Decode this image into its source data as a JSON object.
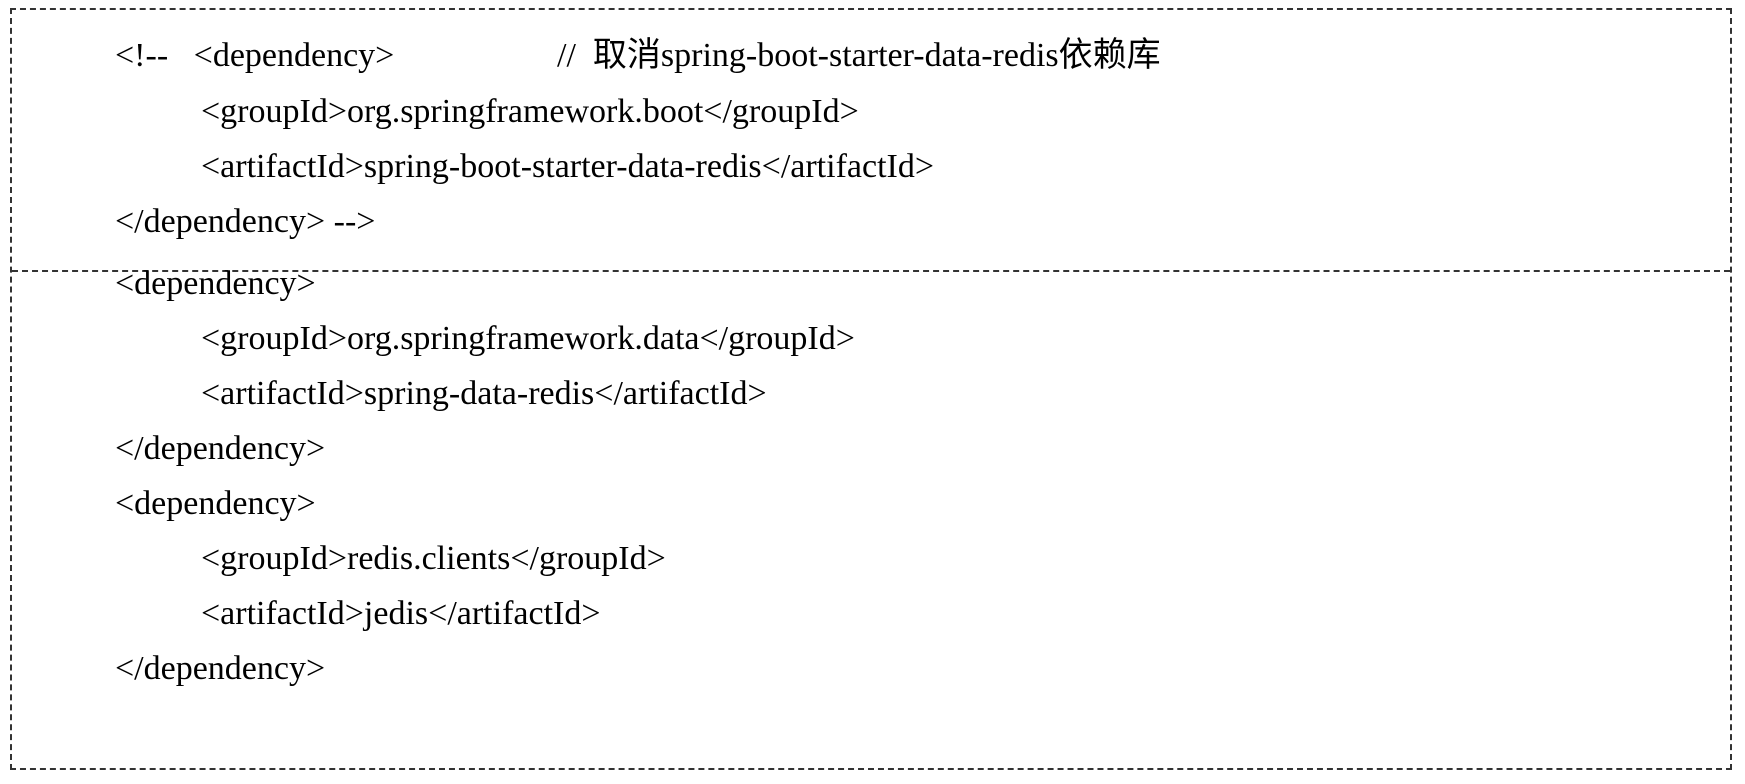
{
  "section_1": {
    "lines": [
      {
        "text": "<!--   <dependency>"
      },
      {
        "text": "<groupId>org.springframework.boot</groupId>"
      },
      {
        "text": "<artifactId>spring-boot-starter-data-redis</artifactId>"
      },
      {
        "text": "</dependency> -->"
      }
    ],
    "comment": "//  取消spring-boot-starter-data-redis依赖库"
  },
  "section_2": {
    "lines": [
      {
        "text": "<dependency>"
      },
      {
        "text": "<groupId>org.springframework.data</groupId>"
      },
      {
        "text": "<artifactId>spring-data-redis</artifactId>"
      },
      {
        "text": "</dependency>"
      },
      {
        "text": "<dependency>"
      },
      {
        "text": "<groupId>redis.clients</groupId>"
      },
      {
        "text": "<artifactId>jedis</artifactId>"
      },
      {
        "text": "</dependency>"
      }
    ]
  }
}
